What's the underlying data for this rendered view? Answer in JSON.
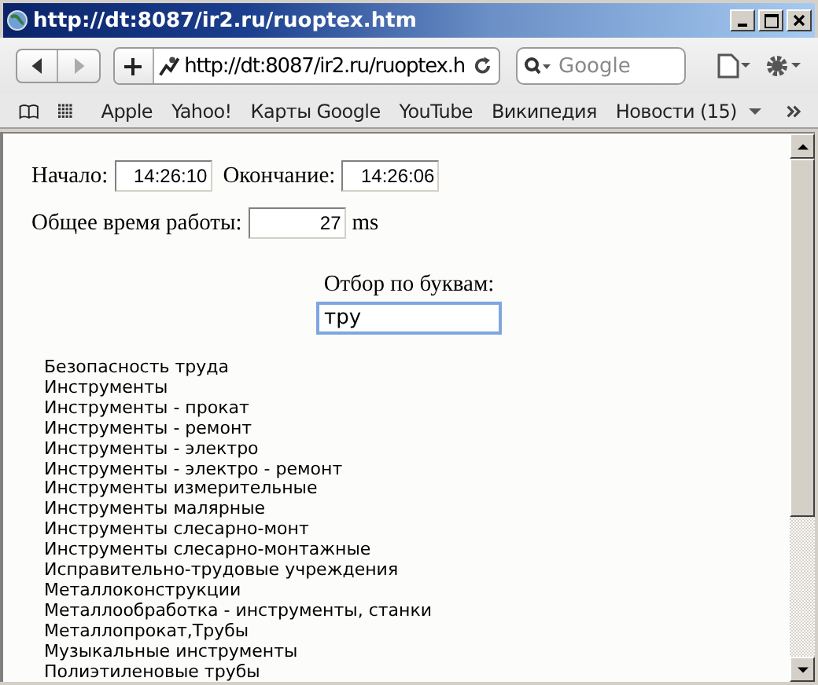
{
  "window": {
    "title": "http://dt:8087/ir2.ru/ruoptex.htm"
  },
  "toolbar": {
    "address": "http://dt:8087/ir2.ru/ruoptex.h",
    "search": {
      "placeholder": "Google"
    }
  },
  "bookmarks": [
    {
      "label": "Apple"
    },
    {
      "label": "Yahoo!"
    },
    {
      "label": "Карты Google"
    },
    {
      "label": "YouTube"
    },
    {
      "label": "Википедия"
    },
    {
      "label": "Новости (15)",
      "kind": "menu"
    }
  ],
  "timing": {
    "start_label": "Начало:",
    "start_value": "14:26:10",
    "end_label": "Окончание:",
    "end_value": "14:26:06",
    "total_label": "Общее время работы:",
    "total_value": "27",
    "unit": "ms"
  },
  "filter": {
    "label": "Отбор по буквам:",
    "value": "тру"
  },
  "results": [
    "Безопасность труда",
    "Инструменты",
    "Инструменты - прокат",
    "Инструменты - ремонт",
    "Инструменты - электро",
    "Инструменты - электро - ремонт",
    "Инструменты измерительные",
    "Инструменты малярные",
    "Инструменты слесарно-монт",
    "Инструменты слесарно-монтажные",
    "Исправительно-трудовые учреждения",
    "Металлоконструкции",
    "Металлообработка - инструменты, станки",
    "Металлопрокат,Трубы",
    "Музыкальные инструменты",
    "Полиэтиленовые трубы"
  ]
}
